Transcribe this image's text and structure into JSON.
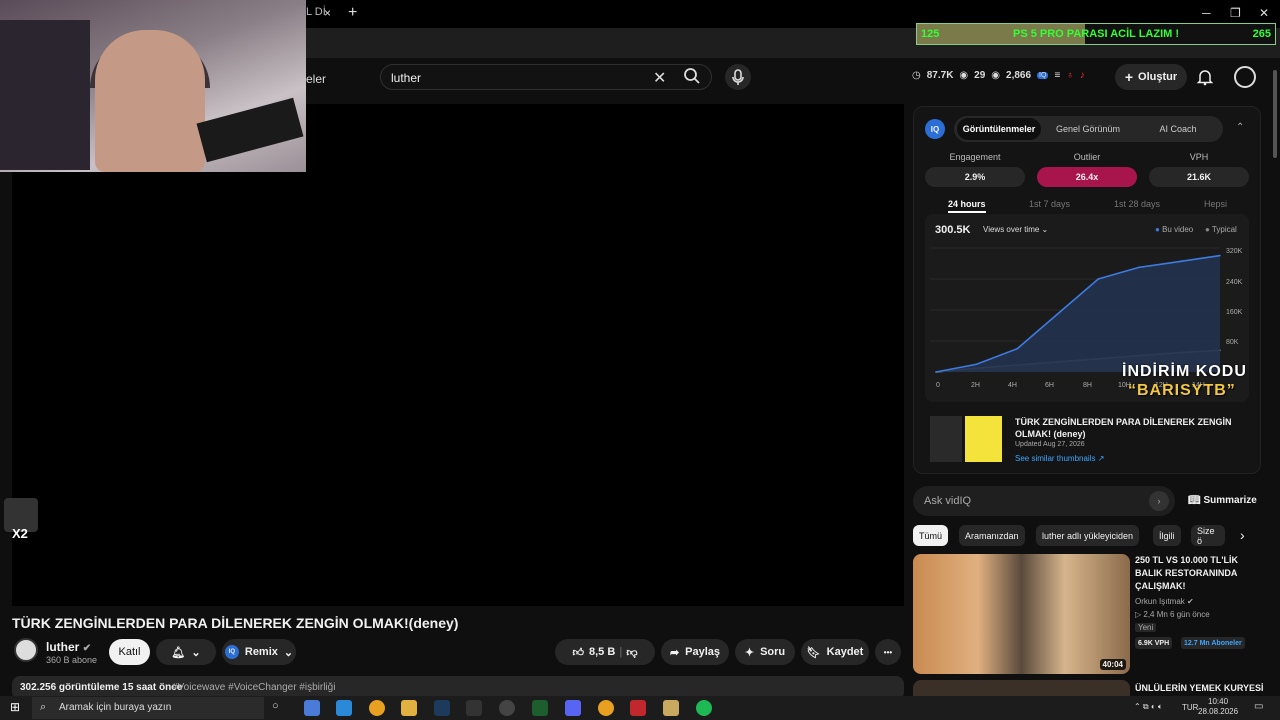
{
  "browser": {
    "tab_fragment": "L Dİ",
    "tab_close": "×",
    "new_tab": "+",
    "win_min": "─",
    "win_max": "❐",
    "win_close": "✕"
  },
  "youtube": {
    "header_fragment": "eler",
    "search_query": "luther",
    "stats": {
      "views": "87.7K",
      "likes": "29",
      "viewers": "2,866"
    },
    "create_label": "Oluştur"
  },
  "stream_overlay": {
    "donation_left": "125",
    "donation_text": "PS 5 PRO PARASI ACİL LAZIM !",
    "donation_right": "265",
    "donation_progress": 0.47,
    "small_label": "X2",
    "promo_line1": "İNDİRİM KODU",
    "promo_line2": "“BARISYTB”"
  },
  "video": {
    "title": "TÜRK ZENGİNLERDEN PARA DİLENEREK ZENGİN OLMAK!(deney)",
    "channel": "luther",
    "subscribers": "360 B abone",
    "join_label": "Katıl",
    "remix_label": "Remix",
    "like_count": "8,5 B",
    "share_label": "Paylaş",
    "ask_label": "Soru",
    "save_label": "Kaydet",
    "more_label": "•••",
    "views_line": "302.256 görüntüleme  15 saat önce",
    "hashtags": "#Voicewave #VoiceChanger #işbirliği"
  },
  "vidiq": {
    "logo": "IQ",
    "tabs": [
      "Görüntülenmeler",
      "Genel Görünüm",
      "AI Coach"
    ],
    "metrics": [
      {
        "label": "Engagement",
        "value": "2.9%"
      },
      {
        "label": "Outlier",
        "value": "26.4x"
      },
      {
        "label": "VPH",
        "value": "21.6K"
      }
    ],
    "range_tabs": [
      "24 hours",
      "1st 7 days",
      "1st 28 days",
      "Hepsi"
    ],
    "total_views": "300.5K",
    "selector_label": "Views over time",
    "legend": [
      "Bu video",
      "Typical"
    ],
    "chart_data": {
      "type": "area",
      "x": [
        "0",
        "2H",
        "4H",
        "6H",
        "8H",
        "10H",
        "12H",
        "14H"
      ],
      "y_ticks": [
        "320K",
        "240K",
        "160K",
        "80K"
      ],
      "ylim": [
        0,
        320000
      ],
      "series": [
        {
          "name": "Bu video",
          "values": [
            0,
            20000,
            60000,
            150000,
            240000,
            270000,
            285000,
            300500
          ]
        },
        {
          "name": "Typical",
          "values": [
            0,
            10000,
            18000,
            26000,
            34000,
            42000,
            50000,
            56000
          ]
        }
      ],
      "colors": {
        "Bu video": "#3d7be0",
        "Typical": "#888888"
      }
    },
    "card": {
      "title": "TÜRK ZENGİNLERDEN PARA DİLENEREK ZENGİN OLMAK! (deney)",
      "updated": "Updated Aug 27, 2026",
      "link": "See similar thumbnails ↗"
    },
    "ask_placeholder": "Ask vidIQ",
    "summarize_label": "Summarize"
  },
  "chips": [
    "Tümü",
    "Aramanızdan",
    "luther adlı yükleyiciden",
    "İlgili",
    "Size ö"
  ],
  "recommendations": [
    {
      "title": "250 TL VS 10.000 TL'LİK BALIK RESTORANINDA ÇALIŞMAK!",
      "channel": "Orkun Işıtmak",
      "meta": "▷ 2,4 Mn   6 gün önce",
      "badge": "Yeni",
      "vph": "6.9K VPH",
      "subs": "12.7 Mn Aboneler",
      "duration": "40:04"
    },
    {
      "title": "ÜNLÜLERİN YEMEK KURYESİ"
    }
  ],
  "taskbar": {
    "search_placeholder": "Aramak için buraya yazın",
    "lang": "TUR",
    "time": "10:40",
    "date": "28.08.2026"
  }
}
